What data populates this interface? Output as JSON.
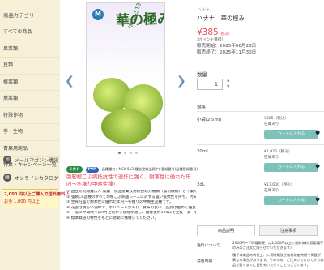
{
  "sidebar": {
    "heading": "商品カテゴリー",
    "items": [
      {
        "label": "すべての商品"
      },
      {
        "label": "果菜類"
      },
      {
        "label": "豆類"
      },
      {
        "label": "根菜類"
      },
      {
        "label": "葉菜類"
      },
      {
        "label": "特殊作物"
      },
      {
        "label": "芋・生物"
      },
      {
        "label": "青果用商品"
      },
      {
        "label": "特集・キャンペーン一覧"
      }
    ],
    "mail_magazine": "メールマガジン購読",
    "online_catalog": "オンラインカタログ",
    "banner_line1": "2,000 円以上ご購入で送料無料!!",
    "banner_line2": "お手 1,000 円以上"
  },
  "gallery": {
    "package_logo": "M",
    "package_title": "華の極み",
    "package_subtitle": "(MSX-513)",
    "prev_arrow": "❮",
    "next_arrow": "❯"
  },
  "product": {
    "brand": "ハナナ",
    "title": "ハナナ　華の極み",
    "price": "¥385",
    "price_tax": "(税込)",
    "points": "3ポイント獲得!",
    "release_start": "販売開始：2025年06月26日",
    "release_end": "販売終了：2025年11月30日",
    "quantity_label": "数量",
    "quantity_value": "1",
    "stepper_up": "▲",
    "stepper_down": "▼",
    "spec_label": "規格"
  },
  "variants": [
    {
      "name": "小袋(2.5ml)",
      "price": "¥385（税込）",
      "stock": "在庫あり",
      "cart_label": "カートに入れる",
      "heart": "♥"
    },
    {
      "name": "20mL",
      "price": "¥1,925（税込）",
      "stock": "在庫あり",
      "cart_label": "カートに入れる",
      "heart": "♥"
    },
    {
      "name": "2dL",
      "price": "¥17,600（税込）",
      "stock": "在庫あり",
      "cart_label": "カートに入れる",
      "heart": "♥"
    }
  ],
  "tabs": {
    "active": "商品説明",
    "other": "注意事項"
  },
  "details": {
    "shipping_term": "送料について",
    "shipping_text": "2000円～「四種郵便」は2,000円以上で送料無料(野菜種子のみのご注文に限らせていただきます)",
    "shipping_note": "種子は商品の特性上、入荷時期及び価格確定時期がハンドメイドのため、下記の時期とは異なる場合がございます。",
    "shipping_label": "発送時期",
    "shipping_text2": "種子は商品の特性上、入荷時期及び価格確定時期で掲載が異なる場合があります。そのため、ご注文いただいてから商品が届くまでに日数をいただくこともございます。"
  },
  "description": {
    "badges": [
      "ミカド",
      "PVP"
    ],
    "badge_text": "品種種名：MSX-513(種苗登録出願中) 登録番号(品種登録番号)",
    "headline": "強靭根こぶ病抵抗性で連作に強く、耐寒性に優れた年内〜冬穫り中晩生種！",
    "bullets": [
      "① 国立研究開発法人 農業・食品産業技術総合研究機構（農研機構）と千葉県、丸種株式会社の三者共同研究により育成された「強靭根こぶ病抵抗性（CR）品種」です。",
      "② 強靭CR品種のすべての根こぶ病菌レースに対する強い抵抗性を持ち、汚染圃場でも安定して栽培できます。",
      "③ 生育旺盛で耐寒性に優れた年内〜冬穫りの中晩生品種です。",
      "④ 花蕾は明るい濃緑で、ボリュームがあり、食味の良い、品質は極めて優良です。",
      "⑤ 一般に中間地では9月上旬から播種が適し、播種後約100日で主枝・第一側枝が収穫始めとなり、しばらくして他に優良な分枝が数多く出て収穫量が上がる多収品種です。",
      "⑥ 標準栽培の特性をもとに適期に播種してください。"
    ]
  }
}
